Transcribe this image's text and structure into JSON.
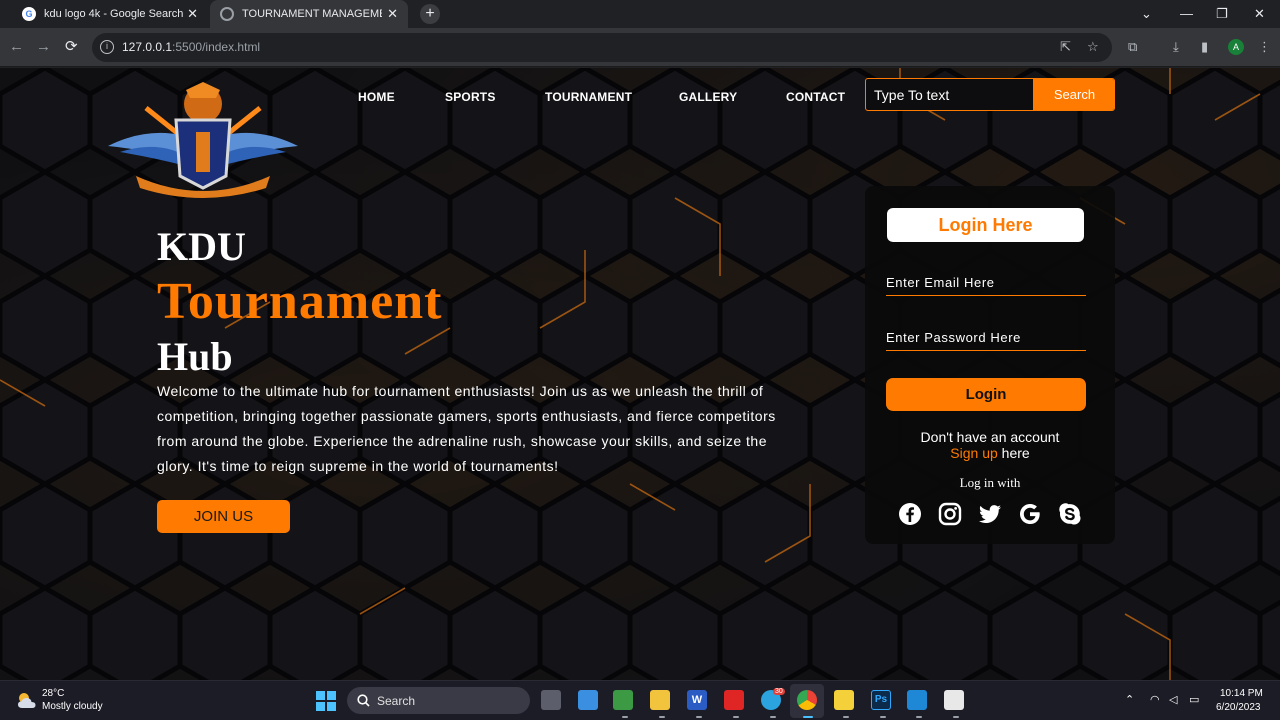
{
  "browser": {
    "tabs": [
      {
        "title": "kdu logo 4k - Google Search",
        "favicon": "google-g-icon"
      },
      {
        "title": "TOURNAMENT MANAGEMENT",
        "favicon": "globe-icon"
      }
    ],
    "url_host": "127.0.0.1",
    "url_rest": ":5500/index.html",
    "profile_initial": "A"
  },
  "nav": {
    "home": "HOME",
    "sports": "SPORTS",
    "tournament": "TOURNAMENT",
    "gallery": "GALLERY",
    "contact": "CONTACT",
    "search_placeholder": "Type To text",
    "search_button": "Search"
  },
  "hero": {
    "line1": "KDU",
    "line2": "Tournament",
    "line3": "Hub",
    "description": "Welcome to the ultimate hub for tournament enthusiasts! Join us as we unleash the thrill of competition, bringing together passionate gamers, sports enthusiasts, and fierce competitors from around the globe. Experience the adrenaline rush, showcase your skills, and seize the glory. It's time to reign supreme in the world of tournaments!",
    "join_button": "JOIN US"
  },
  "login": {
    "title": "Login Here",
    "email_placeholder": "Enter Email Here",
    "password_placeholder": "Enter Password Here",
    "login_button": "Login",
    "no_account": "Don't have an account",
    "signup_link": "Sign up",
    "signup_suffix": " here",
    "login_with": "Log in with",
    "socials": [
      "facebook-icon",
      "instagram-icon",
      "twitter-icon",
      "google-icon",
      "skype-icon"
    ]
  },
  "taskbar": {
    "temperature": "28°C",
    "weather": "Mostly cloudy",
    "search_label": "Search",
    "badge_count": "30",
    "time": "10:14 PM",
    "date": "6/20/2023"
  },
  "colors": {
    "accent": "#ff7a00",
    "page_bg": "#101013",
    "text": "#ffffff"
  }
}
